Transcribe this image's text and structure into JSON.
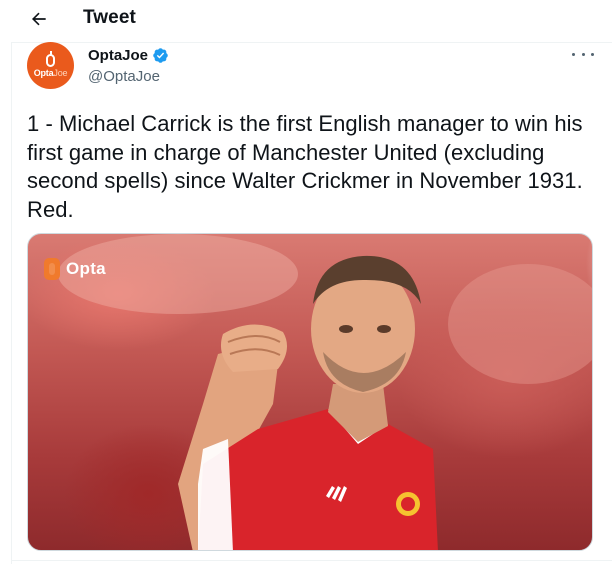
{
  "header": {
    "title": "Tweet"
  },
  "tweet": {
    "author": {
      "name": "OptaJoe",
      "handle": "@OptaJoe",
      "avatar_text_main": "Opta",
      "avatar_text_light": "Joe",
      "verified": true
    },
    "text": "1 - Michael Carrick is the first English manager to win his first game in charge of Manchester United (excluding second spells) since Walter Crickmer in November 1931. Red.",
    "media": {
      "watermark": "Opta",
      "kit_logo": "adidas"
    }
  },
  "colors": {
    "brand_orange": "#ea5a1c",
    "verified_blue": "#1d9bf0",
    "text_primary": "#0f1419",
    "text_secondary": "#536471"
  },
  "icons": {
    "back": "arrow-left-icon",
    "verified": "verified-badge-icon",
    "more": "more-horizontal-icon"
  }
}
